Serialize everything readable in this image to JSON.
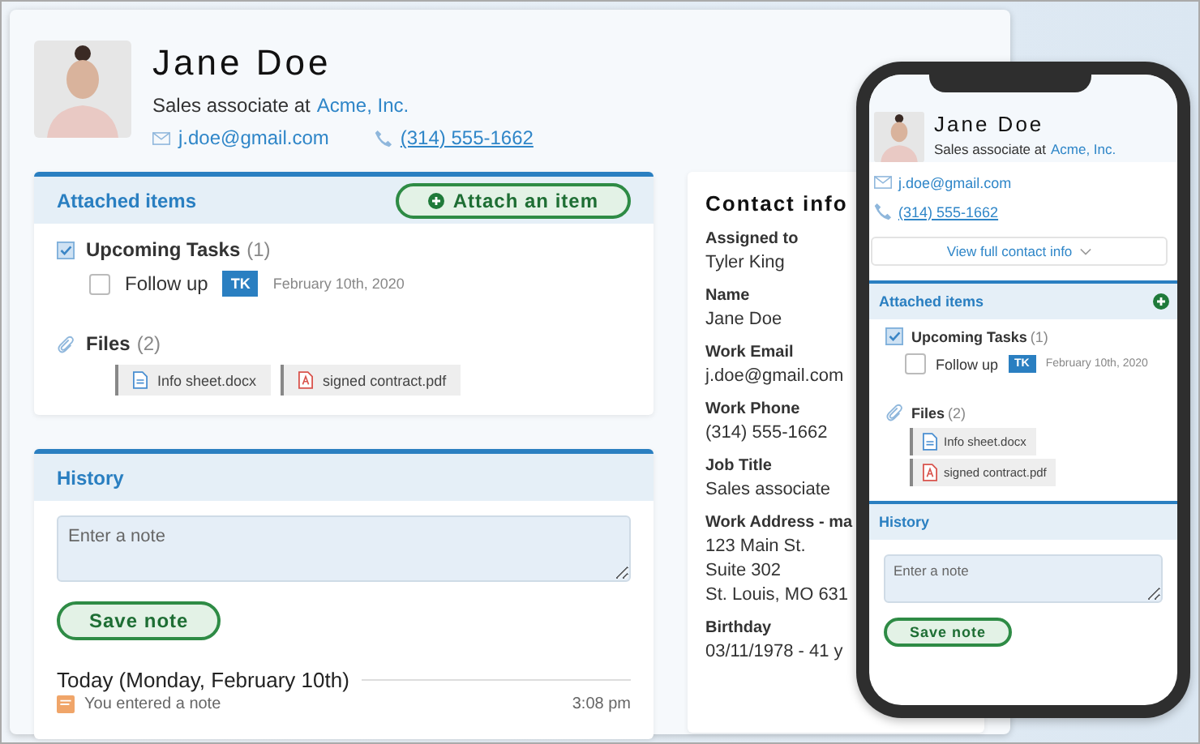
{
  "profile": {
    "name": "Jane Doe",
    "role": "Sales associate at",
    "company": "Acme, Inc.",
    "email": "j.doe@gmail.com",
    "phone": "(314) 555-1662"
  },
  "attached": {
    "title": "Attached items",
    "attach_button": "Attach an item",
    "tasks_label": "Upcoming Tasks",
    "tasks_count": "(1)",
    "tasks": [
      {
        "label": "Follow up",
        "checked": false,
        "assignee": "TK",
        "date": "February 10th, 2020"
      }
    ],
    "files_label": "Files",
    "files_count": "(2)",
    "files": [
      {
        "name": "Info sheet.docx",
        "kind": "doc"
      },
      {
        "name": "signed contract.pdf",
        "kind": "pdf"
      }
    ]
  },
  "history": {
    "title": "History",
    "placeholder": "Enter a note",
    "save_button": "Save note",
    "day": "Today (Monday, February 10th)",
    "entries": [
      {
        "text": "You entered a note",
        "time": "3:08 pm"
      }
    ]
  },
  "contact_info": {
    "title": "Contact info",
    "fields": [
      {
        "label": "Assigned to",
        "lines": [
          "Tyler King"
        ]
      },
      {
        "label": "Name",
        "lines": [
          "Jane Doe"
        ]
      },
      {
        "label": "Work Email",
        "lines": [
          "j.doe@gmail.com"
        ]
      },
      {
        "label": "Work Phone",
        "lines": [
          "(314) 555-1662"
        ]
      },
      {
        "label": "Job Title",
        "lines": [
          "Sales associate"
        ]
      },
      {
        "label": "Work Address - ma",
        "lines": [
          "123 Main St.",
          "Suite 302",
          "St. Louis, MO 631"
        ]
      },
      {
        "label": "Birthday",
        "lines": [
          "03/11/1978 - 41 y"
        ]
      }
    ]
  },
  "phone": {
    "profile": {
      "name": "Jane Doe",
      "role": "Sales associate at",
      "company": "Acme, Inc.",
      "email": "j.doe@gmail.com",
      "phone": "(314) 555-1662"
    },
    "view_button": "View full contact info",
    "attached": {
      "title": "Attached items",
      "tasks_label": "Upcoming Tasks",
      "tasks_count": "(1)",
      "tasks": [
        {
          "label": "Follow up",
          "checked": false,
          "assignee": "TK",
          "date": "February 10th, 2020"
        }
      ],
      "files_label": "Files",
      "files_count": "(2)",
      "files": [
        {
          "name": "Info sheet.docx",
          "kind": "doc"
        },
        {
          "name": "signed contract.pdf",
          "kind": "pdf"
        }
      ]
    },
    "history": {
      "title": "History",
      "placeholder": "Enter a note",
      "save_button": "Save note"
    }
  }
}
